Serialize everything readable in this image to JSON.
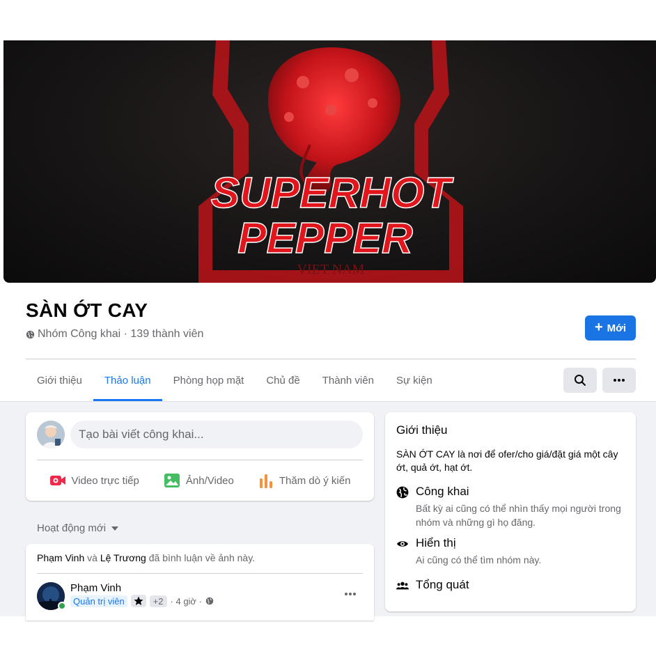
{
  "cover": {
    "logo_line1": "SUPERHOT",
    "logo_line2": "PEPPER",
    "logo_line3": "VIET NAM"
  },
  "group": {
    "name": "SÀN ỚT CAY",
    "meta": "Nhóm Công khai · 139 thành viên",
    "new_button": "Mới"
  },
  "tabs": [
    {
      "label": "Giới thiệu"
    },
    {
      "label": "Thảo luận",
      "active": true
    },
    {
      "label": "Phòng họp mặt"
    },
    {
      "label": "Chủ đề"
    },
    {
      "label": "Thành viên"
    },
    {
      "label": "Sự kiện"
    }
  ],
  "composer": {
    "placeholder": "Tạo bài viết công khai...",
    "actions": {
      "live": "Video trực tiếp",
      "photo": "Ảnh/Video",
      "poll": "Thăm dò ý kiến"
    }
  },
  "feed": {
    "sort_label": "Hoạt động mới"
  },
  "post": {
    "activity_actor": "Phạm Vinh",
    "activity_and": "và",
    "activity_other": "Lệ Trương",
    "activity_text": "đã bình luận về ảnh này.",
    "author": "Phạm Vinh",
    "role": "Quản trị viên",
    "extra_badges": "+2",
    "time": "· 4 giờ ·"
  },
  "about": {
    "title": "Giới thiệu",
    "description": "SÀN ỚT CAY là nơi để ofer/cho giá/đặt giá một cây ớt, quả ớt, hạt ớt.",
    "public_title": "Công khai",
    "public_desc": "Bất kỳ ai cũng có thể nhìn thấy mọi người trong nhóm và những gì họ đăng.",
    "visible_title": "Hiển thị",
    "visible_desc": "Ai cũng có thể tìm nhóm này.",
    "general_title": "Tổng quát"
  },
  "colors": {
    "accent": "#1877f2",
    "button": "#1b74e4",
    "cover_red": "#d61a1a"
  }
}
